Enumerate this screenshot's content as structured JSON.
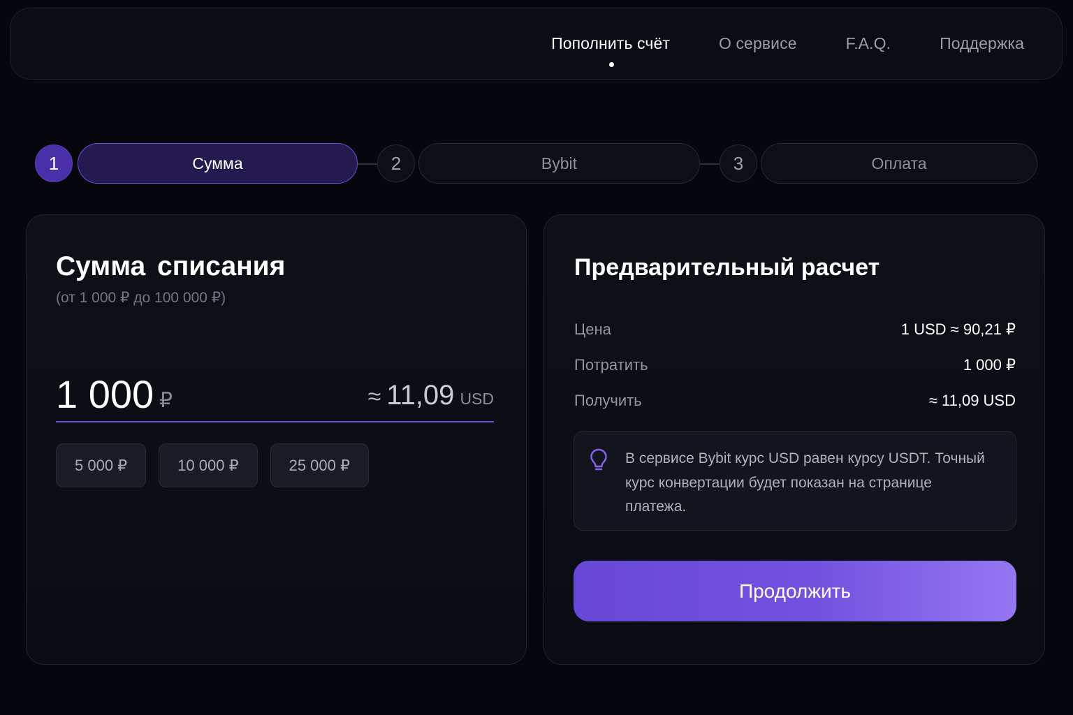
{
  "nav": {
    "items": [
      {
        "label": "Пополнить счёт",
        "active": true
      },
      {
        "label": "О сервисе",
        "active": false
      },
      {
        "label": "F.A.Q.",
        "active": false
      },
      {
        "label": "Поддержка",
        "active": false
      }
    ]
  },
  "stepper": {
    "steps": [
      {
        "number": "1",
        "label": "Сумма",
        "active": true
      },
      {
        "number": "2",
        "label": "Bybit",
        "active": false
      },
      {
        "number": "3",
        "label": "Оплата",
        "active": false
      }
    ]
  },
  "amount_card": {
    "title": "Сумма списания",
    "range": "(от 1 000 ₽ до 100 000 ₽)",
    "value": "1 000",
    "currency": "₽",
    "conversion_approx": "≈",
    "conversion_value": "11,09",
    "conversion_currency": "USD",
    "presets": [
      "5 000 ₽",
      "10 000 ₽",
      "25 000 ₽"
    ]
  },
  "calc_card": {
    "title": "Предварительный расчет",
    "rows": [
      {
        "label": "Цена",
        "value": "1 USD ≈ 90,21 ₽"
      },
      {
        "label": "Потратить",
        "value": "1 000 ₽"
      },
      {
        "label": "Получить",
        "value": "≈ 11,09 USD"
      }
    ],
    "info_icon": "lightbulb-icon",
    "info_text": "В сервисе Bybit курс USD равен курсу USDT. Точный курс конвертации будет показан на странице платежа.",
    "continue_label": "Продолжить"
  },
  "colors": {
    "accent": "#6a4fd6",
    "background": "#05070d",
    "card": "#0e1018"
  }
}
